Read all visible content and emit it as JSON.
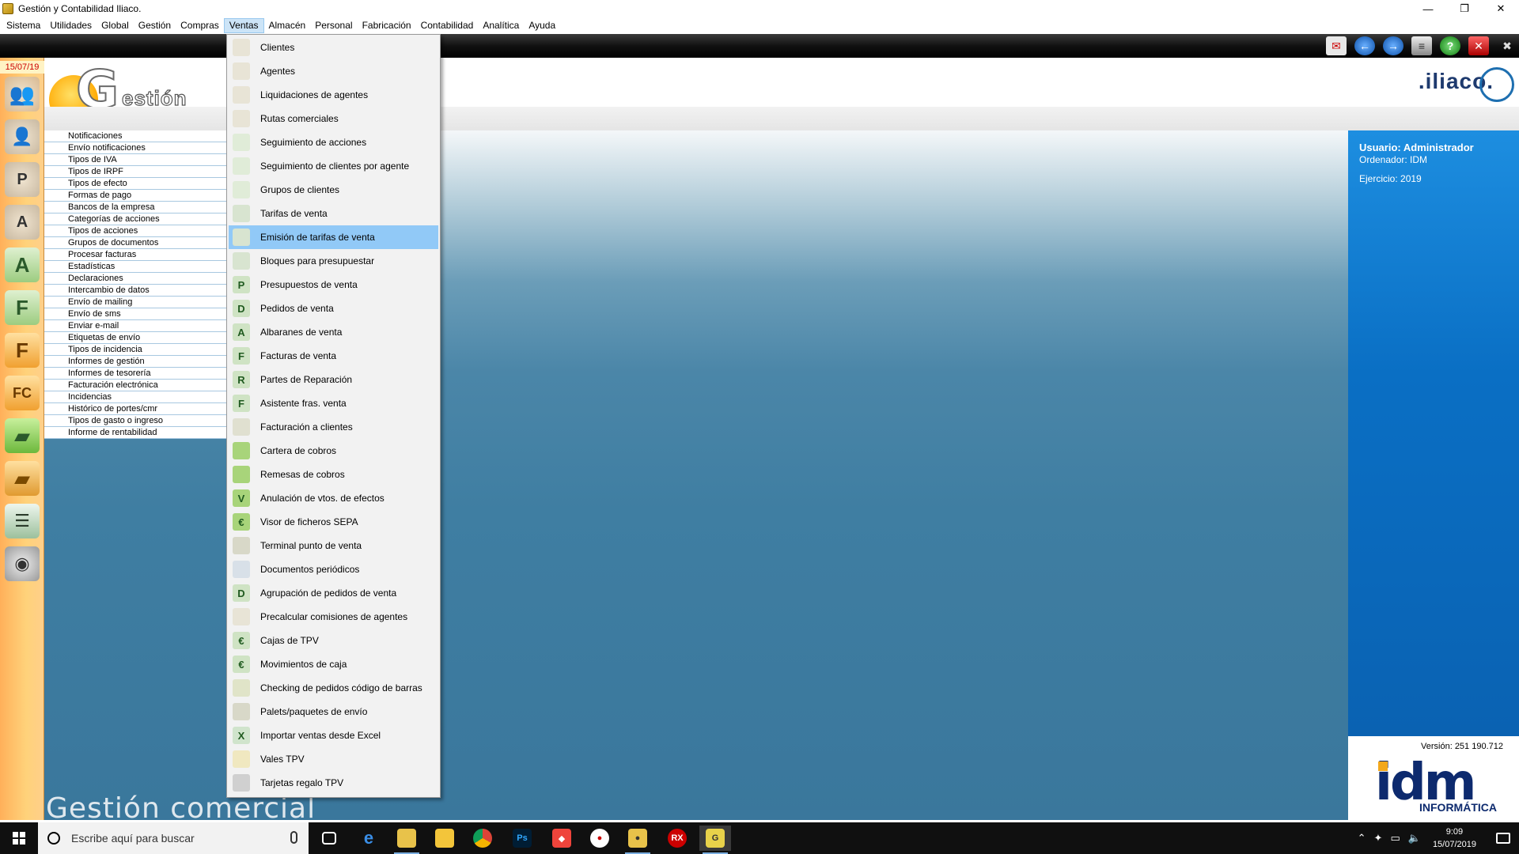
{
  "window": {
    "title": "Gestión y Contabilidad Iliaco.",
    "min": "—",
    "max": "❐",
    "close": "✕"
  },
  "menubar": [
    {
      "label": "Sistema"
    },
    {
      "label": "Utilidades"
    },
    {
      "label": "Global"
    },
    {
      "label": "Gestión"
    },
    {
      "label": "Compras"
    },
    {
      "label": "Ventas",
      "active": true
    },
    {
      "label": "Almacén"
    },
    {
      "label": "Personal"
    },
    {
      "label": "Fabricación"
    },
    {
      "label": "Contabilidad"
    },
    {
      "label": "Analítica"
    },
    {
      "label": "Ayuda"
    }
  ],
  "rail": {
    "date": "15/07/19"
  },
  "header": {
    "logo_G": "G",
    "logo_rest": "estión",
    "brand": ".iliaco."
  },
  "left_list": [
    "Notificaciones",
    "Envío notificaciones",
    "Tipos de IVA",
    "Tipos de IRPF",
    "Tipos de efecto",
    "Formas de pago",
    "Bancos de la empresa",
    "Categorías de acciones",
    "Tipos de acciones",
    "Grupos de documentos",
    "Procesar facturas",
    "Estadísticas",
    "Declaraciones",
    "Intercambio de datos",
    "Envío de mailing",
    "Envío de sms",
    "Enviar e-mail",
    "Etiquetas de envío",
    "Tipos de incidencia",
    "Informes de gestión",
    "Informes de tesorería",
    "Facturación electrónica",
    "Incidencias",
    "Histórico de portes/cmr",
    "Tipos de gasto o ingreso",
    "Informe de rentabilidad"
  ],
  "content": {
    "title": "Gestión comercial"
  },
  "info": {
    "usuario": "Usuario: Administrador",
    "ordenador": "Ordenador: IDM",
    "ejercicio": "Ejercicio: 2019",
    "version": "Versión: 251 190.712",
    "company": "idm",
    "company_sub": "INFORMÁTICA"
  },
  "dropdown": [
    {
      "label": "Clientes",
      "icon": "person-icon",
      "bg": "#e8e4d6"
    },
    {
      "label": "Agentes",
      "icon": "person-icon",
      "bg": "#e8e4d6"
    },
    {
      "label": "Liquidaciones de agentes",
      "icon": "person-icon",
      "bg": "#e8e4d6"
    },
    {
      "label": "Rutas comerciales",
      "icon": "route-icon",
      "bg": "#e8e4d6"
    },
    {
      "label": "Seguimiento de acciones",
      "icon": "person-icon",
      "bg": "#e0ecd8"
    },
    {
      "label": "Seguimiento de clientes por agente",
      "icon": "person-search-icon",
      "bg": "#e0ecd8"
    },
    {
      "label": "Grupos de clientes",
      "icon": "group-icon",
      "bg": "#e0ecd8"
    },
    {
      "label": "Tarifas de venta",
      "icon": "euro-icon",
      "bg": "#d8e4d0"
    },
    {
      "label": "Emisión de tarifas de venta",
      "icon": "euro-print-icon",
      "bg": "#d8e4d0",
      "highlight": true
    },
    {
      "label": "Bloques para presupuestar",
      "icon": "blocks-icon",
      "bg": "#d8e4d0"
    },
    {
      "label": "Presupuestos de venta",
      "icon": "letter-p-icon",
      "letter": "P",
      "bg": "#cfe3c4"
    },
    {
      "label": "Pedidos de venta",
      "icon": "letter-d-icon",
      "letter": "D",
      "bg": "#cfe3c4"
    },
    {
      "label": "Albaranes de venta",
      "icon": "letter-a-icon",
      "letter": "A",
      "bg": "#cfe3c4"
    },
    {
      "label": "Facturas de venta",
      "icon": "letter-f-icon",
      "letter": "F",
      "bg": "#cfe3c4"
    },
    {
      "label": "Partes de Reparación",
      "icon": "letter-r-icon",
      "letter": "R",
      "bg": "#cfe3c4"
    },
    {
      "label": "Asistente fras. venta",
      "icon": "wizard-icon",
      "letter": "F",
      "bg": "#cfe3c4"
    },
    {
      "label": "Facturación a clientes",
      "icon": "billing-icon",
      "bg": "#e0e0d0"
    },
    {
      "label": "Cartera de cobros",
      "icon": "wallet-icon",
      "bg": "#a8d47a"
    },
    {
      "label": "Remesas de cobros",
      "icon": "wallet-icon",
      "bg": "#a8d47a"
    },
    {
      "label": "Anulación de vtos. de efectos",
      "icon": "letter-v-icon",
      "letter": "V",
      "bg": "#a8d47a"
    },
    {
      "label": "Visor de ficheros SEPA",
      "icon": "sepa-icon",
      "letter": "€",
      "bg": "#a8d47a"
    },
    {
      "label": "Terminal punto de venta",
      "icon": "pos-icon",
      "bg": "#d8d8c8"
    },
    {
      "label": "Documentos periódicos",
      "icon": "calendar-icon",
      "bg": "#d8e0e8"
    },
    {
      "label": "Agrupación de pedidos de venta",
      "icon": "merge-icon",
      "letter": "D",
      "bg": "#cfe3c4"
    },
    {
      "label": "Precalcular comisiones de agentes",
      "icon": "person-icon",
      "bg": "#e8e4d6"
    },
    {
      "label": "Cajas de TPV",
      "icon": "cashbox-icon",
      "letter": "€",
      "bg": "#cfe3c4"
    },
    {
      "label": "Movimientos de caja",
      "icon": "cash-move-icon",
      "letter": "€",
      "bg": "#cfe3c4"
    },
    {
      "label": "Checking de pedidos código de barras",
      "icon": "barcode-icon",
      "bg": "#e0e4c8"
    },
    {
      "label": "Palets/paquetes de envío",
      "icon": "pallet-icon",
      "bg": "#d8d8c8"
    },
    {
      "label": "Importar ventas desde Excel",
      "icon": "excel-icon",
      "letter": "X",
      "bg": "#d0e4cc"
    },
    {
      "label": "Vales TPV",
      "icon": "voucher-icon",
      "bg": "#f0e8c0"
    },
    {
      "label": "Tarjetas regalo TPV",
      "icon": "giftcard-icon",
      "bg": "#d0d0d0"
    }
  ],
  "taskbar": {
    "search_placeholder": "Escribe aquí para buscar",
    "time": "9:09",
    "date": "15/07/2019"
  }
}
